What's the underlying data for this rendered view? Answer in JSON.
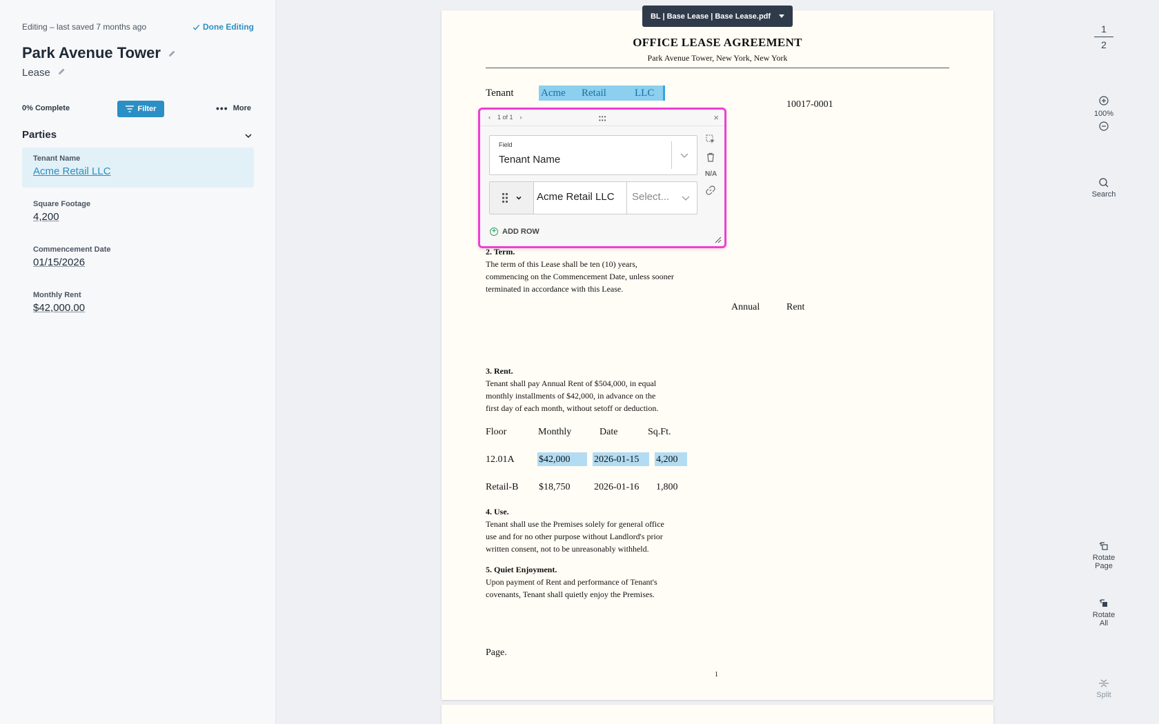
{
  "sidebar": {
    "status": "Editing – last saved 7 months ago",
    "done_label": "Done Editing",
    "title": "Park Avenue Tower",
    "doc_type": "Lease",
    "complete": "0% Complete",
    "filter_label": "Filter",
    "more_label": "More",
    "section": "Parties",
    "fields": [
      {
        "label": "Tenant Name",
        "value": "Acme Retail LLC"
      },
      {
        "label": "Square Footage",
        "value": "4,200"
      },
      {
        "label": "Commencement Date",
        "value": "01/15/2026"
      },
      {
        "label": "Monthly Rent",
        "value": "$42,000.00"
      }
    ]
  },
  "doc_tab": "BL | Base Lease | Base Lease.pdf",
  "document": {
    "title": "OFFICE LEASE AGREEMENT",
    "subtitle": "Park Avenue Tower, New York, New York",
    "tenant_label": "Tenant",
    "tenant_words": [
      "Acme",
      "Retail",
      "LLC"
    ],
    "zip": "10017-0001",
    "term_heading": "2. Term.",
    "term_lines": [
      "The term of this Lease shall be ten (10) years,",
      "commencing on the Commencement Date, unless sooner",
      "terminated in accordance with this Lease."
    ],
    "annual": "Annual",
    "rent": "Rent",
    "rent_heading": "3. Rent.",
    "rent_lines": [
      "Tenant shall pay Annual Rent of $504,000, in equal",
      "monthly installments of $42,000, in advance on the",
      "first day of each month, without setoff or deduction."
    ],
    "table_headers": [
      "Floor",
      "Monthly",
      "Date",
      "Sq.Ft."
    ],
    "table_rows": [
      [
        "12.01A",
        "$42,000",
        "2026-01-15",
        "4,200"
      ],
      [
        "Retail-B",
        "$18,750",
        "2026-01-16",
        "1,800"
      ]
    ],
    "use_heading": "4. Use.",
    "use_lines": [
      "Tenant shall use the Premises solely for general office",
      "use and for no other purpose without Landlord's prior",
      "written consent, not to be unreasonably withheld."
    ],
    "quiet_heading": "5. Quiet Enjoyment.",
    "quiet_lines": [
      "Upon payment of Rent and performance of Tenant's",
      "covenants, Tenant shall quietly enjoy the Premises."
    ],
    "page_word": "Page.",
    "page_number": "1"
  },
  "popover": {
    "counter": "1 of 1",
    "field_label": "Field",
    "field_value": "Tenant Name",
    "na": "N/A",
    "row_value": "Acme Retail LLC",
    "select_placeholder": "Select...",
    "add_row": "ADD ROW"
  },
  "right_toolbar": {
    "page_current": "1",
    "page_total": "2",
    "zoom": "100%",
    "search": "Search",
    "rotate_page_1": "Rotate",
    "rotate_page_2": "Page",
    "rotate_all_1": "Rotate",
    "rotate_all_2": "All",
    "split": "Split"
  },
  "colors": {
    "accent": "#2a8fc4",
    "popover_border": "#f03ed5",
    "highlight": "#b3dcf2"
  }
}
